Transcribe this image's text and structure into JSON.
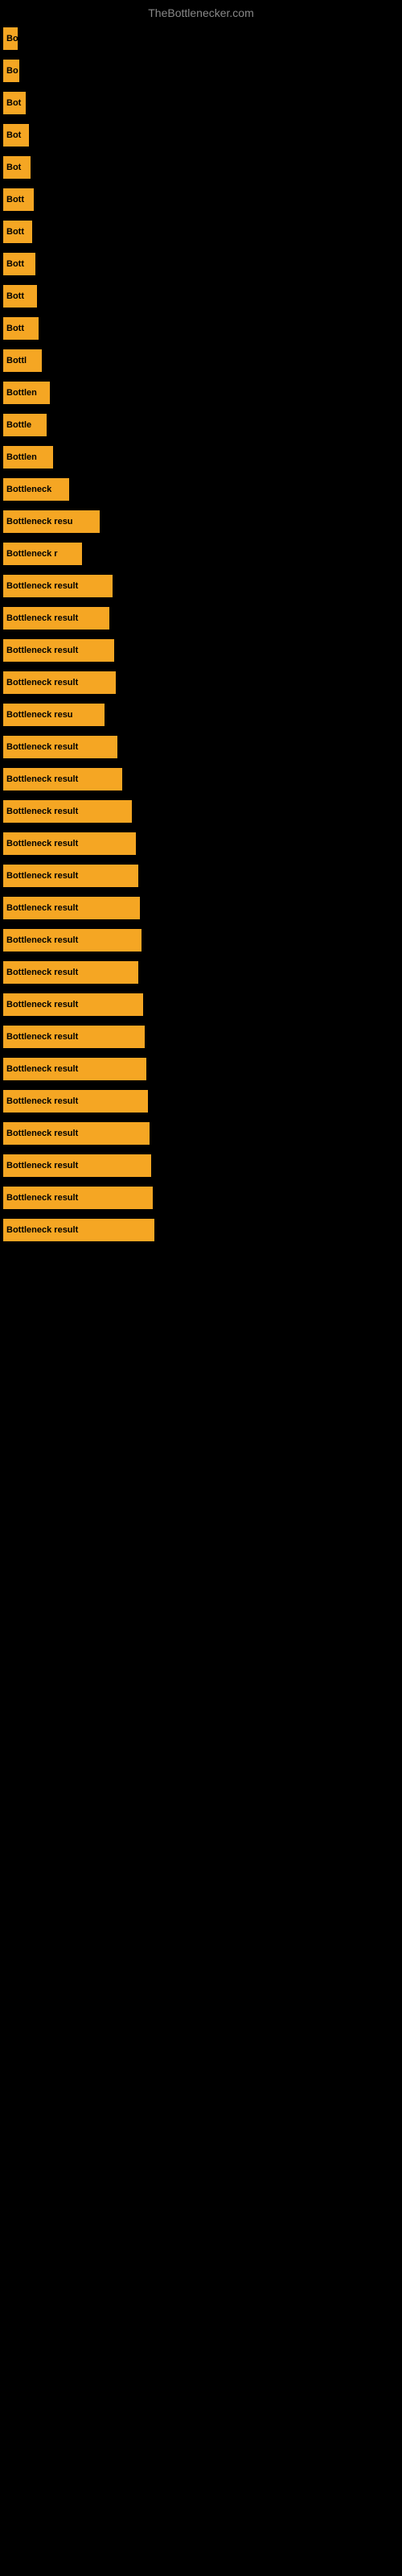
{
  "site": {
    "title": "TheBottlenecker.com"
  },
  "bars": [
    {
      "label": "Bo",
      "width": 18
    },
    {
      "label": "Bo",
      "width": 20
    },
    {
      "label": "Bot",
      "width": 28
    },
    {
      "label": "Bot",
      "width": 32
    },
    {
      "label": "Bot",
      "width": 34
    },
    {
      "label": "Bott",
      "width": 38
    },
    {
      "label": "Bott",
      "width": 36
    },
    {
      "label": "Bott",
      "width": 40
    },
    {
      "label": "Bott",
      "width": 42
    },
    {
      "label": "Bott",
      "width": 44
    },
    {
      "label": "Bottl",
      "width": 48
    },
    {
      "label": "Bottlen",
      "width": 58
    },
    {
      "label": "Bottle",
      "width": 54
    },
    {
      "label": "Bottlen",
      "width": 62
    },
    {
      "label": "Bottleneck",
      "width": 82
    },
    {
      "label": "Bottleneck resu",
      "width": 120
    },
    {
      "label": "Bottleneck r",
      "width": 98
    },
    {
      "label": "Bottleneck result",
      "width": 136
    },
    {
      "label": "Bottleneck result",
      "width": 132
    },
    {
      "label": "Bottleneck result",
      "width": 138
    },
    {
      "label": "Bottleneck result",
      "width": 140
    },
    {
      "label": "Bottleneck resu",
      "width": 126
    },
    {
      "label": "Bottleneck result",
      "width": 142
    },
    {
      "label": "Bottleneck result",
      "width": 148
    },
    {
      "label": "Bottleneck result",
      "width": 160
    },
    {
      "label": "Bottleneck result",
      "width": 165
    },
    {
      "label": "Bottleneck result",
      "width": 168
    },
    {
      "label": "Bottleneck result",
      "width": 170
    },
    {
      "label": "Bottleneck result",
      "width": 172
    },
    {
      "label": "Bottleneck result",
      "width": 168
    },
    {
      "label": "Bottleneck result",
      "width": 174
    },
    {
      "label": "Bottleneck result",
      "width": 176
    },
    {
      "label": "Bottleneck result",
      "width": 178
    },
    {
      "label": "Bottleneck result",
      "width": 180
    },
    {
      "label": "Bottleneck result",
      "width": 182
    },
    {
      "label": "Bottleneck result",
      "width": 184
    },
    {
      "label": "Bottleneck result",
      "width": 186
    },
    {
      "label": "Bottleneck result",
      "width": 188
    }
  ]
}
